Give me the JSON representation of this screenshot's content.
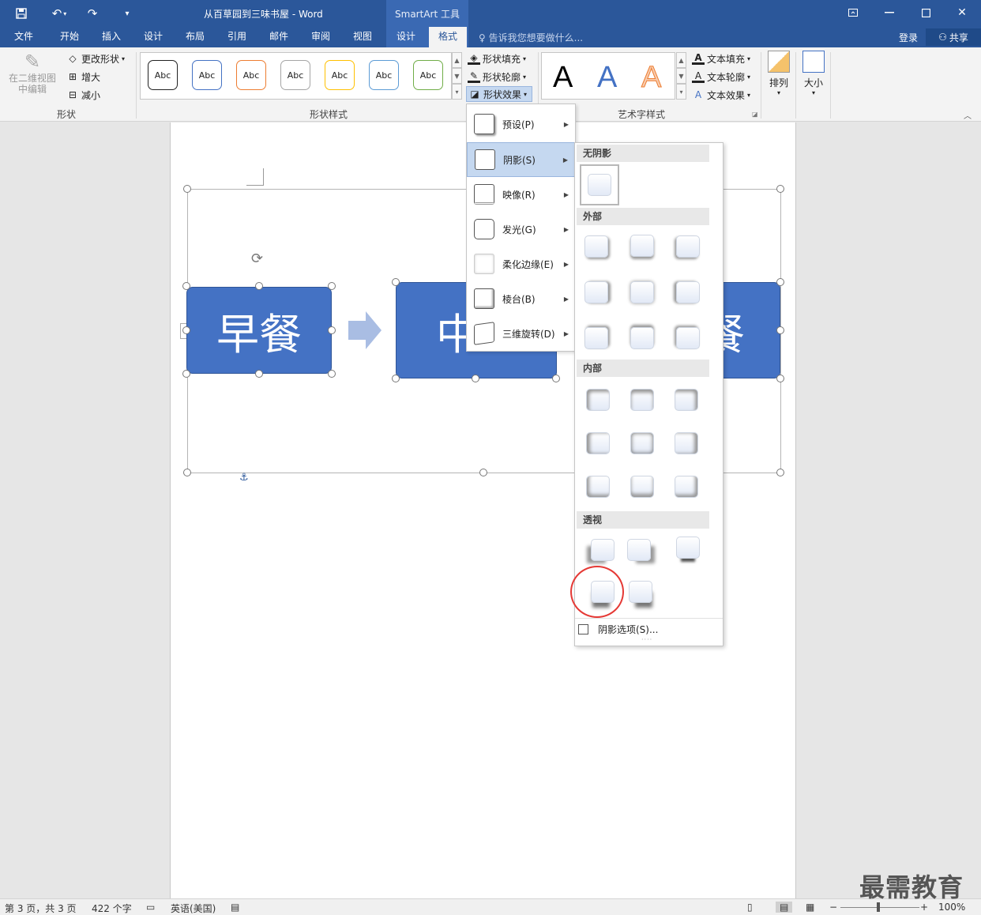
{
  "app": {
    "doc_title": "从百草园到三味书屋 - Word",
    "context_tool": "SmartArt 工具",
    "window_icons": [
      "restore-ribbon-icon",
      "minimize-icon",
      "maximize-icon",
      "close-icon"
    ]
  },
  "tabs": [
    "文件",
    "开始",
    "插入",
    "设计",
    "布局",
    "引用",
    "邮件",
    "审阅",
    "视图",
    "设计",
    "格式"
  ],
  "tell_me": "告诉我您想要做什么...",
  "account": {
    "login": "登录",
    "share": "共享"
  },
  "ribbon": {
    "shape_group": {
      "edit_in_2d": "在二维视图中编辑",
      "change_shape": "更改形状",
      "larger": "增大",
      "smaller": "减小",
      "label": "形状"
    },
    "shape_styles": {
      "sample": "Abc",
      "colors": [
        "#222222",
        "#4472c4",
        "#ed7d31",
        "#a5a5a5",
        "#ffc000",
        "#5b9bd5",
        "#70ad47"
      ],
      "fill": "形状填充",
      "outline": "形状轮廓",
      "effects": "形状效果",
      "label": "形状样式"
    },
    "wordart": {
      "letter": "A",
      "text_fill": "文本填充",
      "text_outline": "文本轮廓",
      "text_effects": "文本效果",
      "label": "艺术字样式"
    },
    "arrange": "排列",
    "size": "大小"
  },
  "smartart": {
    "nodes": [
      "早餐",
      "中",
      "餐"
    ]
  },
  "effects_menu": [
    {
      "label": "预设(P)"
    },
    {
      "label": "阴影(S)"
    },
    {
      "label": "映像(R)"
    },
    {
      "label": "发光(G)"
    },
    {
      "label": "柔化边缘(E)"
    },
    {
      "label": "棱台(B)"
    },
    {
      "label": "三维旋转(D)"
    }
  ],
  "shadow_panel": {
    "sections": [
      "无阴影",
      "外部",
      "内部",
      "透视"
    ],
    "options": "阴影选项(S)..."
  },
  "status": {
    "page": "第 3 页，共 3 页",
    "words": "422 个字",
    "language": "英语(美国)",
    "zoom": "100%"
  },
  "watermark": "最需教育"
}
